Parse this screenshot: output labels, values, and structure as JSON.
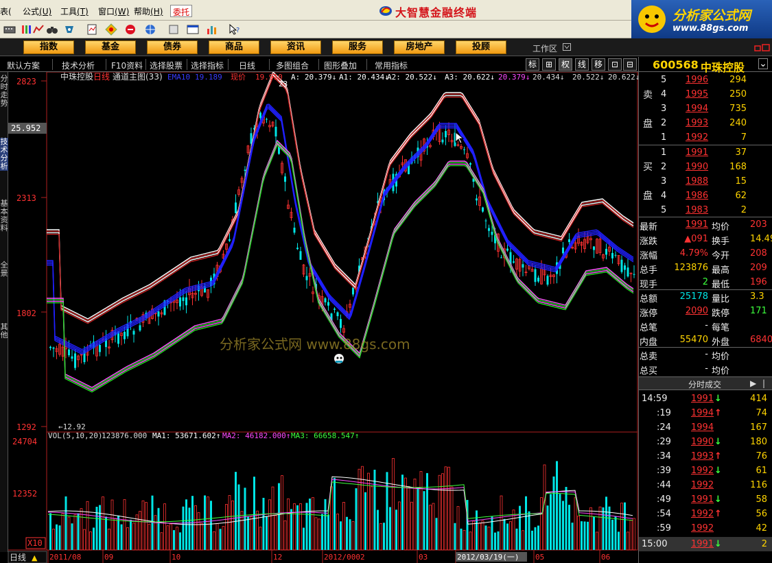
{
  "menubar": {
    "items": [
      "表(",
      "公式",
      "工具",
      "窗口",
      "帮助"
    ],
    "shortcuts": [
      "",
      "(U)",
      "(T)",
      "(W)",
      "(H)"
    ],
    "commission": "委托",
    "app_title": "大智慧金融终端"
  },
  "brand": {
    "site_name": "分析家公式网",
    "site_url": "www.88gs.com",
    "watermark": "分析家公式网 www.88gs.com"
  },
  "categories": [
    "指数",
    "基金",
    "债券",
    "商品",
    "资讯",
    "服务",
    "房地产",
    "投顾"
  ],
  "workspace": "工作区",
  "subbar": {
    "items": [
      "默认方案",
      "技术分析",
      "F10资料",
      "选择股票",
      "选择指标",
      "日线",
      "多图组合",
      "图形叠加",
      "常用指标"
    ],
    "mini_buttons": [
      "标",
      "⊞",
      "权",
      "线",
      "移",
      "⊡",
      "⊟"
    ],
    "active_buttons": [
      "权"
    ]
  },
  "left_tabs": [
    "分时走势",
    "技术分析",
    "基本资料",
    "全景",
    "其他"
  ],
  "chart": {
    "title": "中珠控股",
    "period": "日线",
    "indicator": "通道主图(33)",
    "ema_label": "EMA10",
    "ema_value": "19.189",
    "xianjia_label": "现价",
    "xianjia_value": "19.910",
    "a_values": [
      {
        "label": "A:",
        "value": "20.379",
        "arrow": "↓"
      },
      {
        "label": "A1:",
        "value": "20.434",
        "arrow": "↓"
      },
      {
        "label": "A2:",
        "value": "20.522",
        "arrow": "↓"
      },
      {
        "label": "A3:",
        "value": "20.622",
        "arrow": "↓"
      },
      {
        "label": "",
        "value": "20.379",
        "arrow": "↓"
      },
      {
        "label": "",
        "value": "20.434",
        "arrow": "↓"
      },
      {
        "label": "",
        "value": "20.522",
        "arrow": "↓"
      },
      {
        "label": "",
        "value": "20.622",
        "arrow": "↓"
      }
    ],
    "peak_label": "23",
    "y_labels": [
      "2823",
      "2313",
      "1802",
      "1292"
    ],
    "cursor_price": "25.952",
    "low_label": "12.92",
    "vol_title": "VOL(5,10,20)",
    "vol_value": "123876.000",
    "ma1": {
      "label": "MA1:",
      "value": "53671.602"
    },
    "ma2": {
      "label": "MA2:",
      "value": "46182.000"
    },
    "ma3": {
      "label": "MA3:",
      "value": "66658.547"
    },
    "vol_y_labels": [
      "24704",
      "12352"
    ],
    "vol_unit": "X10",
    "x_labels": [
      "2011/08",
      "09",
      "10",
      "12",
      "2012/0002",
      "03",
      "2012/03/19(一)",
      "05",
      "06"
    ],
    "bottom_tab": "日线"
  },
  "stock": {
    "code": "600568",
    "name": "中珠控股",
    "sell_label": "卖盘",
    "buy_label": "买盘",
    "asks": [
      {
        "level": "5",
        "price": "1996",
        "vol": "294"
      },
      {
        "level": "4",
        "price": "1995",
        "vol": "250"
      },
      {
        "level": "3",
        "price": "1994",
        "vol": "735"
      },
      {
        "level": "2",
        "price": "1993",
        "vol": "240"
      },
      {
        "level": "1",
        "price": "1992",
        "vol": "7"
      }
    ],
    "bids": [
      {
        "level": "1",
        "price": "1991",
        "vol": "37"
      },
      {
        "level": "2",
        "price": "1990",
        "vol": "168"
      },
      {
        "level": "3",
        "price": "1988",
        "vol": "15"
      },
      {
        "level": "4",
        "price": "1986",
        "vol": "62"
      },
      {
        "level": "5",
        "price": "1983",
        "vol": "2"
      }
    ],
    "stats": [
      {
        "l1": "最新",
        "v1": "1991",
        "c1": "red",
        "l2": "均价",
        "v2": "203",
        "c2": "red"
      },
      {
        "l1": "涨跌",
        "v1": "▲091",
        "c1": "red",
        "l2": "换手",
        "v2": "14.49",
        "c2": "yel"
      },
      {
        "l1": "涨幅",
        "v1": "4.79%",
        "c1": "red",
        "l2": "今开",
        "v2": "208",
        "c2": "red"
      },
      {
        "l1": "总手",
        "v1": "123876",
        "c1": "yel",
        "l2": "最高",
        "v2": "209",
        "c2": "red"
      },
      {
        "l1": "现手",
        "v1": "2",
        "c1": "green",
        "l2": "最低",
        "v2": "196",
        "c2": "red"
      },
      {
        "l1": "总额",
        "v1": "25178",
        "c1": "cyan",
        "l2": "量比",
        "v2": "3.3",
        "c2": "yel"
      },
      {
        "l1": "涨停",
        "v1": "2090",
        "c1": "red",
        "l2": "跌停",
        "v2": "171",
        "c2": "green"
      },
      {
        "l1": "总笔",
        "v1": "-",
        "c1": "wht",
        "l2": "每笔",
        "v2": "",
        "c2": "wht"
      },
      {
        "l1": "内盘",
        "v1": "55470",
        "c1": "yel",
        "l2": "外盘",
        "v2": "6840",
        "c2": "red"
      },
      {
        "l1": "总卖",
        "v1": "-",
        "c1": "wht",
        "l2": "均价",
        "v2": "",
        "c2": "wht"
      },
      {
        "l1": "总买",
        "v1": "-",
        "c1": "wht",
        "l2": "均价",
        "v2": "",
        "c2": "wht"
      }
    ],
    "trades_header": "分时成交",
    "trades": [
      {
        "time": "14:59",
        "price": "1991",
        "dir": "↓",
        "vol": "414"
      },
      {
        "time": ":19",
        "price": "1994",
        "dir": "↑",
        "vol": "74"
      },
      {
        "time": ":24",
        "price": "1994",
        "dir": "",
        "vol": "167"
      },
      {
        "time": ":29",
        "price": "1990",
        "dir": "↓",
        "vol": "180"
      },
      {
        "time": ":34",
        "price": "1993",
        "dir": "↑",
        "vol": "76"
      },
      {
        "time": ":39",
        "price": "1992",
        "dir": "↓",
        "vol": "61"
      },
      {
        "time": ":44",
        "price": "1992",
        "dir": "",
        "vol": "116"
      },
      {
        "time": ":49",
        "price": "1991",
        "dir": "↓",
        "vol": "58"
      },
      {
        "time": ":54",
        "price": "1992",
        "dir": "↑",
        "vol": "56"
      },
      {
        "time": ":59",
        "price": "1992",
        "dir": "",
        "vol": "42"
      },
      {
        "time": "15:00",
        "price": "1991",
        "dir": "↓",
        "vol": "2"
      }
    ]
  }
}
